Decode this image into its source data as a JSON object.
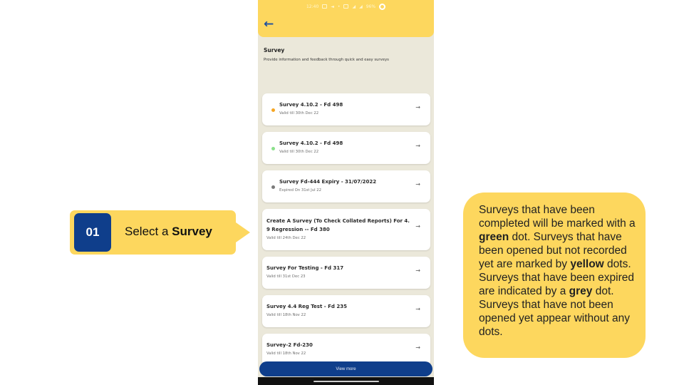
{
  "callout_step": {
    "number": "01",
    "text_prefix": "Select a ",
    "text_bold": "Survey"
  },
  "callout_info": {
    "parts": [
      {
        "t": "Surveys that have been completed will be marked with a ",
        "b": false
      },
      {
        "t": "green",
        "b": true
      },
      {
        "t": " dot. Surveys that have been opened but not recorded yet are marked by ",
        "b": false
      },
      {
        "t": "yellow",
        "b": true
      },
      {
        "t": " dots. Surveys that have been expired are indicated by a ",
        "b": false
      },
      {
        "t": "grey",
        "b": true
      },
      {
        "t": " dot. Surveys that have not been opened yet appear without any dots.",
        "b": false
      }
    ]
  },
  "phone": {
    "status_time": "12:40",
    "status_battery": "96%",
    "header": {
      "back_icon": "arrow-left-icon"
    },
    "page": {
      "title": "Survey",
      "subtitle": "Provide information and feedback through quick and easy surveys"
    },
    "surveys": [
      {
        "title": "Survey 4.10.2 - Fd 498",
        "subtitle": "Valid till 30th Dec 22",
        "dot": "#f5a623"
      },
      {
        "title": "Survey 4.10.2 - Fd 498",
        "subtitle": "Valid till 30th Dec 22",
        "dot": "#8be08b"
      },
      {
        "title": "Survey Fd-444 Expiry - 31/07/2022",
        "subtitle": "Expired On 31st Jul 22",
        "dot": "#7a7a7a"
      },
      {
        "title_line1": "Create A Survey (To Check Collated Reports) For 4.",
        "title_line2": "9 Regression -- Fd 380",
        "subtitle": "Valid till 24th Dec 22"
      },
      {
        "title": "Survey For Testing - Fd 317",
        "subtitle": "Valid till 31st Dec 23"
      },
      {
        "title": "Survey 4.4 Reg Test - Fd 235",
        "subtitle": "Valid till 18th Nov 22"
      },
      {
        "title": "Survey-2 Fd-230",
        "subtitle": "Valid till 18th Nov 22"
      }
    ],
    "view_more_label": "View more",
    "arrow_glyph": "→"
  },
  "colors": {
    "accent_yellow": "#fdd75e",
    "brand_blue": "#0f3e8b",
    "screen_bg": "#ebe8da"
  }
}
